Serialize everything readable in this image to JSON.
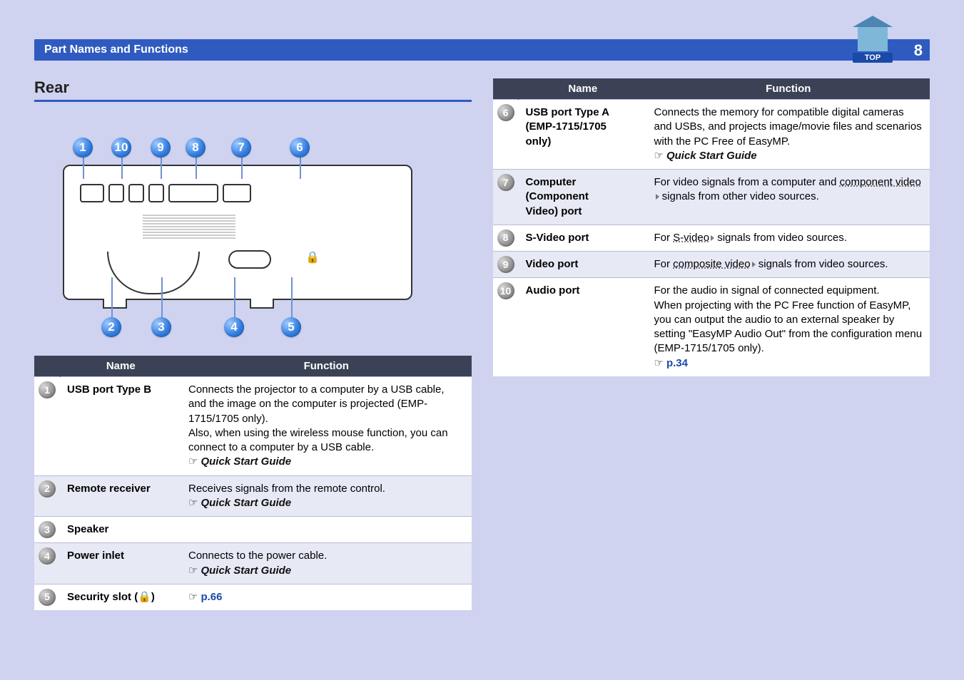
{
  "header": {
    "title": "Part Names and Functions",
    "page": "8",
    "top_label": "TOP"
  },
  "table_headers": {
    "name": "Name",
    "func": "Function"
  },
  "refs": {
    "qsg": "Quick Start Guide"
  },
  "callouts": [
    "1",
    "2",
    "3",
    "4",
    "5",
    "6",
    "7",
    "8",
    "9",
    "10"
  ],
  "left": {
    "section_title": "Rear",
    "rows": [
      {
        "num": "1",
        "name": "USB port Type B",
        "func": "Connects the projector to a computer by a USB cable, and the image on the computer is projected (EMP-1715/1705 only).\nAlso, when using the wireless mouse function, you can connect to a computer by a USB cable."
      },
      {
        "num": "2",
        "name": "Remote receiver",
        "func": "Receives signals from the remote control."
      },
      {
        "num": "3",
        "name": "Speaker",
        "func": ""
      },
      {
        "num": "4",
        "name": "Power inlet",
        "func": "Connects to the power cable."
      },
      {
        "num": "5",
        "name": "Security slot",
        "ref": "p.66"
      }
    ]
  },
  "right": {
    "rows": [
      {
        "num": "6",
        "name_l1": "USB port Type A",
        "name_l2": "(EMP-1715/1705",
        "name_l3": "only)",
        "func": "Connects the memory for compatible digital cameras and USBs, and projects image/movie files and scenarios with the PC Free of EasyMP."
      },
      {
        "num": "7",
        "name_l1": "Computer",
        "name_l2": "(Component",
        "name_l3": "Video) port",
        "func_a": "For video signals from a computer and ",
        "glossary": "component video",
        "func_b": " signals from other video sources."
      },
      {
        "num": "8",
        "name": "S-Video port",
        "func_a": "For ",
        "glossary": "S-video",
        "func_b": " signals from video sources."
      },
      {
        "num": "9",
        "name": "Video port",
        "func_a": "For ",
        "glossary": "composite video",
        "func_b": " signals from video sources."
      },
      {
        "num": "10",
        "name": "Audio port",
        "func": "For the audio in signal of connected equipment.\nWhen projecting with the PC Free function of EasyMP, you can output the audio to an external speaker by setting \"EasyMP Audio Out\" from the configuration menu (EMP-1715/1705 only).",
        "ref": "p.34"
      }
    ]
  }
}
